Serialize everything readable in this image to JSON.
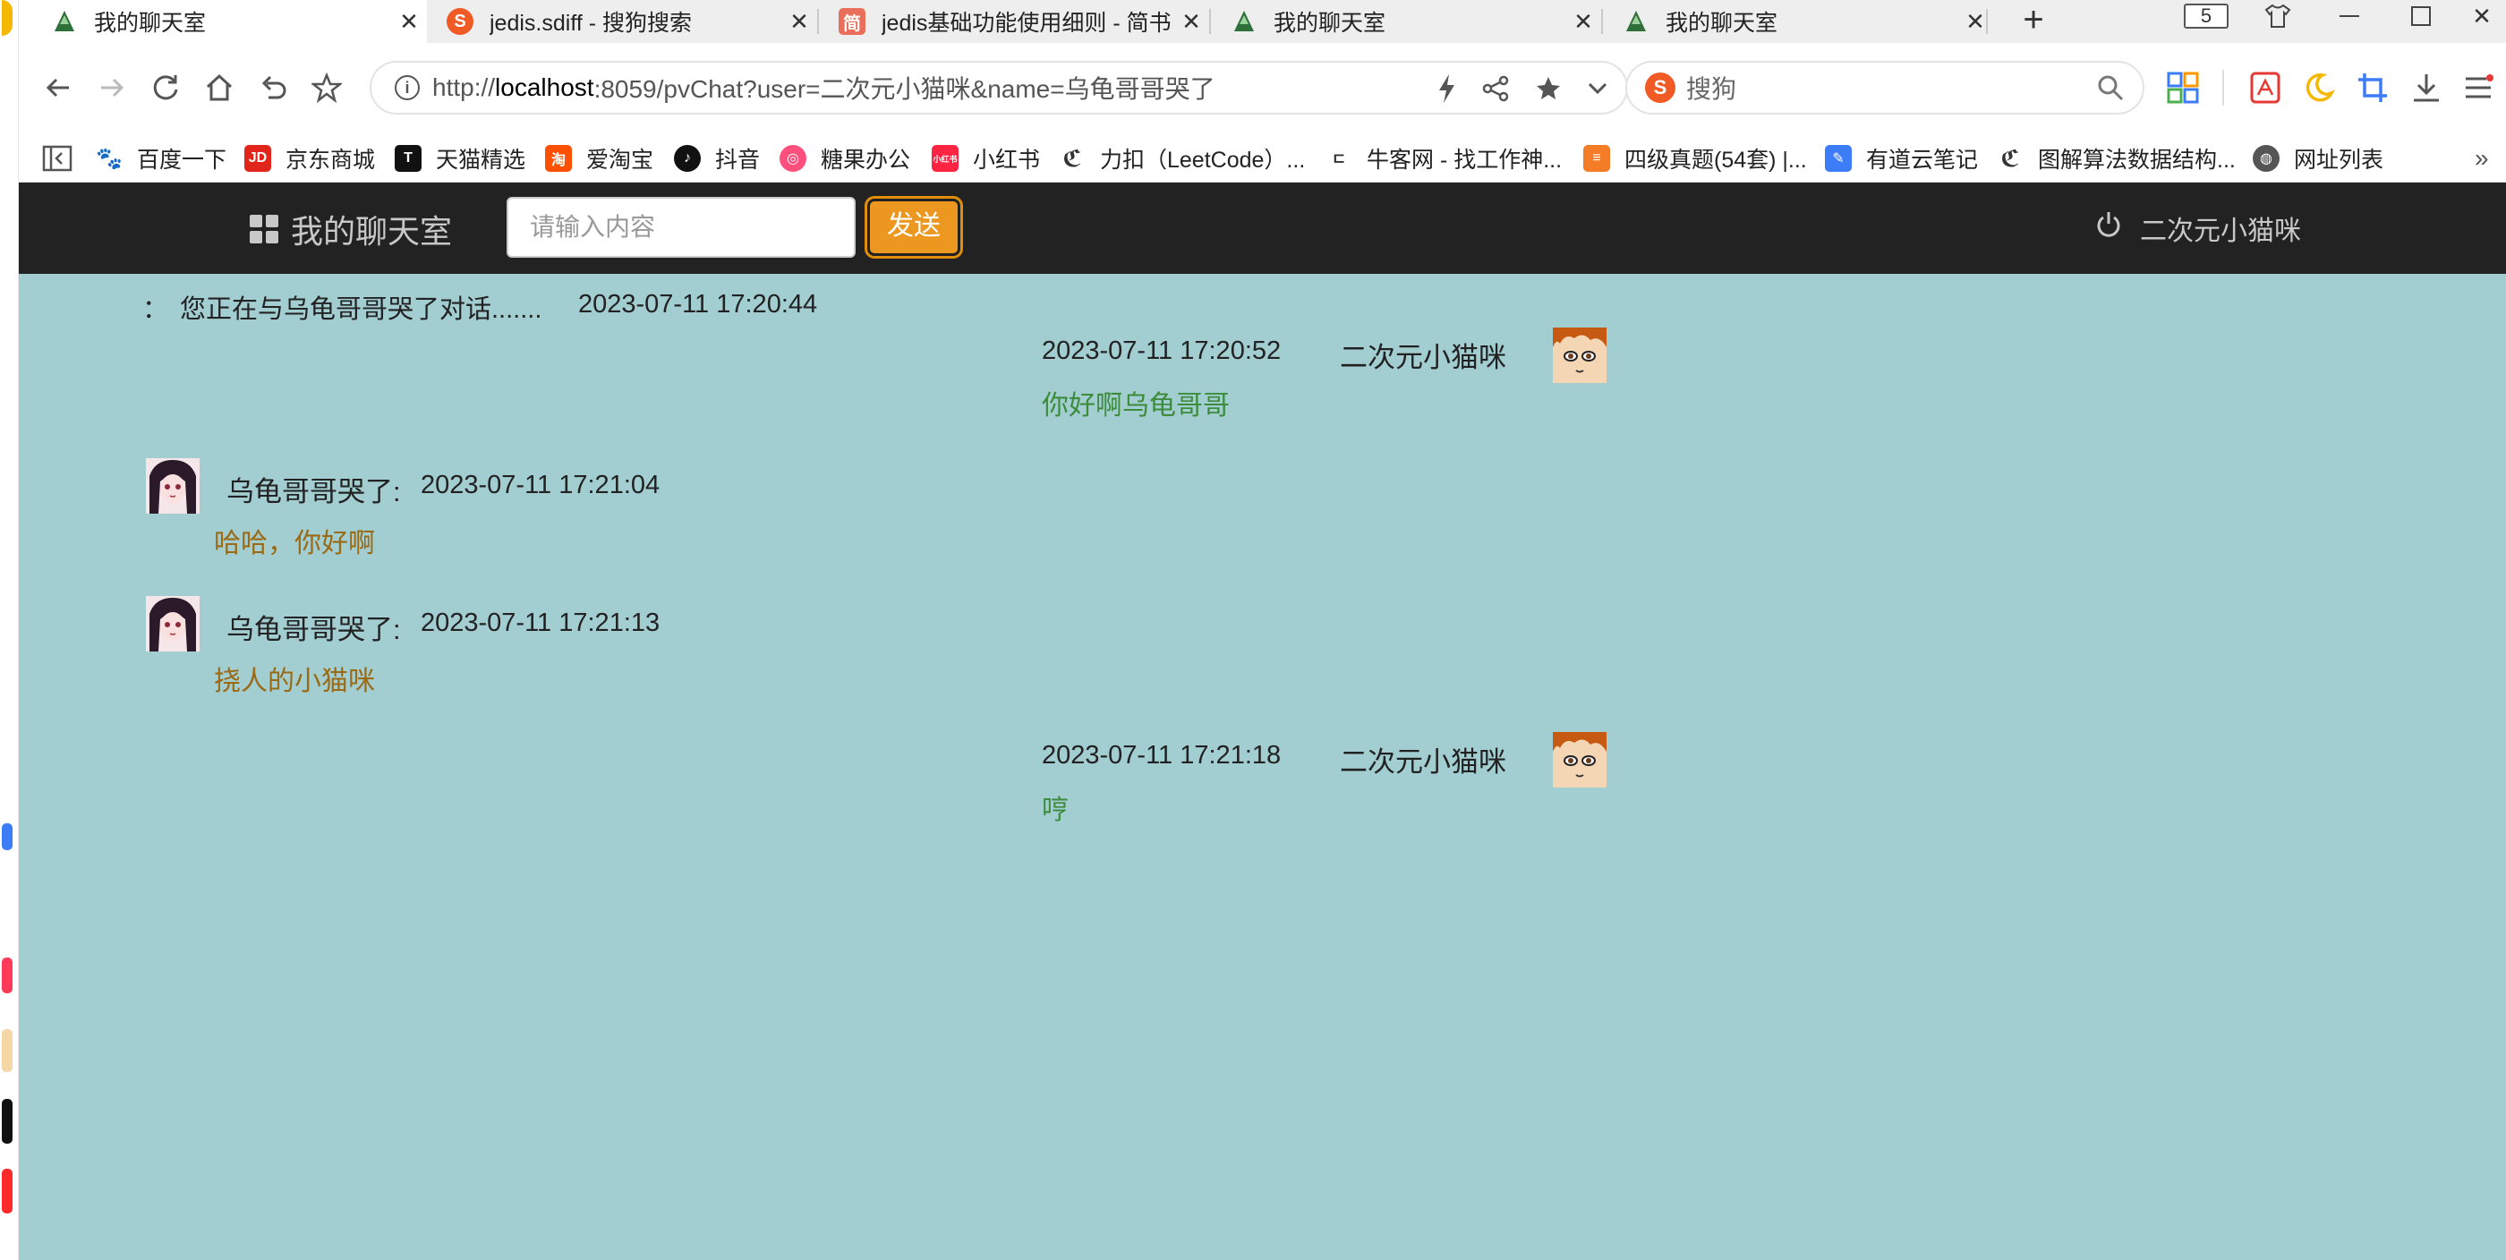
{
  "browser": {
    "tabs": [
      {
        "title": "我的聊天室",
        "active": true
      },
      {
        "title": "jedis.sdiff - 搜狗搜索",
        "active": false
      },
      {
        "title": "jedis基础功能使用细则 - 简书",
        "active": false
      },
      {
        "title": "我的聊天室",
        "active": false
      },
      {
        "title": "我的聊天室",
        "active": false
      }
    ],
    "tab_count": "5",
    "url_prefix": "http://",
    "url_host": "localhost",
    "url_rest": ":8059/pvChat?user=二次元小猫咪&name=乌龟哥哥哭了",
    "search_placeholder": "搜狗",
    "bookmarks": [
      {
        "label": "百度一下",
        "icon": "baidu-icon",
        "color": "#2932e1"
      },
      {
        "label": "京东商城",
        "icon": "jd-icon",
        "color": "#e1251b"
      },
      {
        "label": "天猫精选",
        "icon": "tmall-icon",
        "color": "#111111"
      },
      {
        "label": "爱淘宝",
        "icon": "taobao-icon",
        "color": "#ff5000"
      },
      {
        "label": "抖音",
        "icon": "douyin-icon",
        "color": "#111111"
      },
      {
        "label": "糖果办公",
        "icon": "candy-icon",
        "color": "#ff4f7d"
      },
      {
        "label": "小红书",
        "icon": "xiaohongshu-icon",
        "color": "#ff2442"
      },
      {
        "label": "力扣（LeetCode）...",
        "icon": "leetcode-icon",
        "color": "#333333"
      },
      {
        "label": "牛客网 - 找工作神...",
        "icon": "nowcoder-icon",
        "color": "#333333"
      },
      {
        "label": "四级真题(54套) |...",
        "icon": "doc-icon",
        "color": "#f57c27"
      },
      {
        "label": "有道云笔记",
        "icon": "youdao-icon",
        "color": "#3d7cf7"
      },
      {
        "label": "图解算法数据结构...",
        "icon": "leetcode-icon",
        "color": "#333333"
      },
      {
        "label": "网址列表",
        "icon": "globe-icon",
        "color": "#555555"
      }
    ]
  },
  "app": {
    "brand": "我的聊天室",
    "input_placeholder": "请输入内容",
    "send_label": "发送",
    "current_user": "二次元小猫咪",
    "system_prefix": "：",
    "system_message": "您正在与乌龟哥哥哭了对话.......",
    "system_time": "2023-07-11 17:20:44",
    "messages": [
      {
        "side": "right",
        "time": "2023-07-11 17:20:52",
        "name": "二次元小猫咪",
        "text": "你好啊乌龟哥哥"
      },
      {
        "side": "left",
        "name": "乌龟哥哥哭了:",
        "time": "2023-07-11 17:21:04",
        "text": "哈哈，你好啊"
      },
      {
        "side": "left",
        "name": "乌龟哥哥哭了:",
        "time": "2023-07-11 17:21:13",
        "text": "挠人的小猫咪"
      },
      {
        "side": "right",
        "time": "2023-07-11 17:21:18",
        "name": "二次元小猫咪",
        "text": "哼"
      }
    ]
  },
  "colors": {
    "page_bg": "#a2cdd1",
    "navbar_bg": "#222222",
    "send_button": "#ec971f",
    "right_text": "#3c8c3c",
    "left_text": "#9a6a14"
  }
}
